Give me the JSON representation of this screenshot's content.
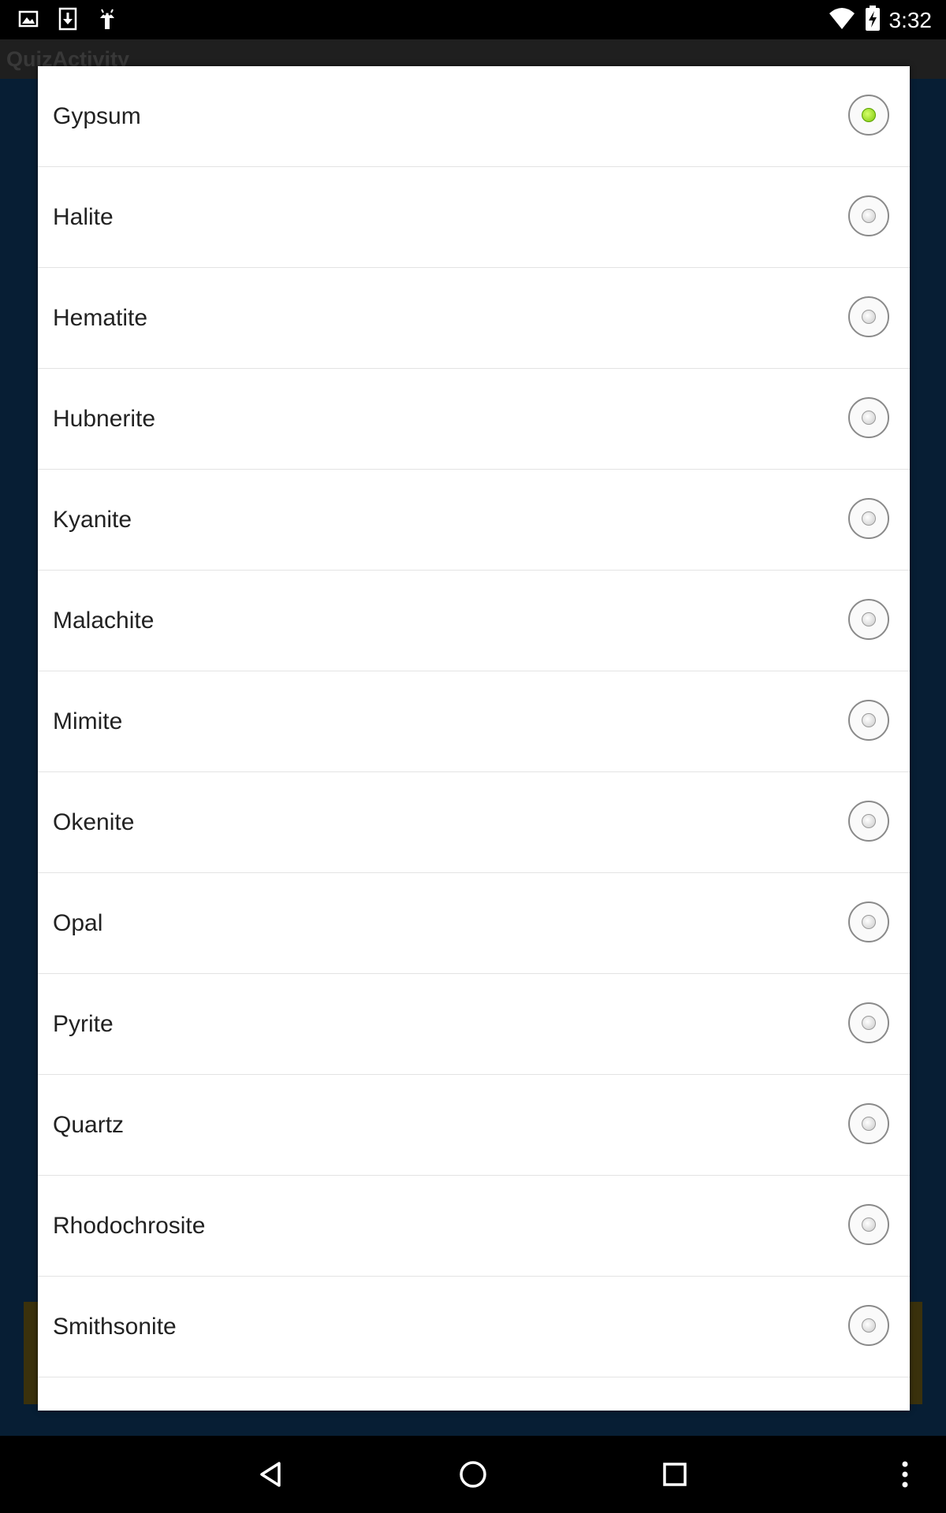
{
  "status_bar": {
    "time": "3:32",
    "icons": [
      "image-icon",
      "download-icon",
      "android-icon",
      "wifi-icon",
      "battery-charging-icon"
    ]
  },
  "app": {
    "title": "QuizActivity"
  },
  "dialog": {
    "selected_index": 0,
    "options": [
      {
        "label": "Gypsum",
        "checked": true
      },
      {
        "label": "Halite",
        "checked": false
      },
      {
        "label": "Hematite",
        "checked": false
      },
      {
        "label": "Hubnerite",
        "checked": false
      },
      {
        "label": "Kyanite",
        "checked": false
      },
      {
        "label": "Malachite",
        "checked": false
      },
      {
        "label": "Mimite",
        "checked": false
      },
      {
        "label": "Okenite",
        "checked": false
      },
      {
        "label": "Opal",
        "checked": false
      },
      {
        "label": "Pyrite",
        "checked": false
      },
      {
        "label": "Quartz",
        "checked": false
      },
      {
        "label": "Rhodochrosite",
        "checked": false
      },
      {
        "label": "Smithsonite",
        "checked": false
      }
    ]
  },
  "nav_bar": {
    "icons": [
      "back-icon",
      "home-icon",
      "recents-icon",
      "overflow-menu-icon"
    ]
  },
  "colors": {
    "selected_radio": "#7cc60a",
    "app_background": "#0d3760",
    "dialog_background": "#ffffff"
  }
}
